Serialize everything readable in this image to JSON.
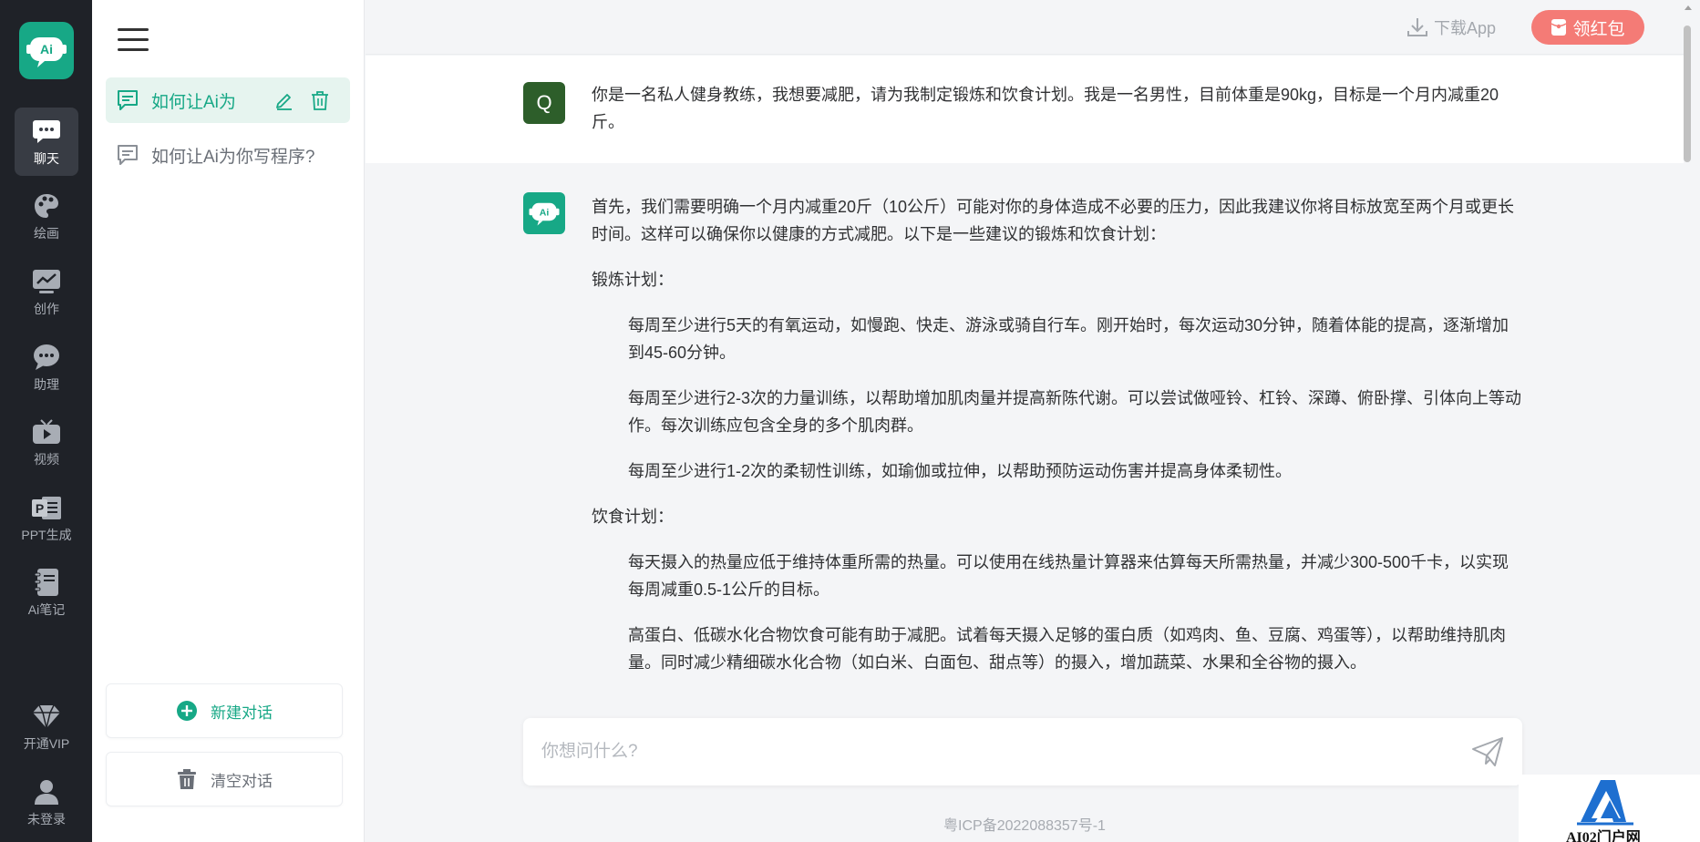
{
  "rail": {
    "logo_text": "Ai",
    "items": [
      {
        "label": "聊天",
        "icon": "chat-bubble-icon",
        "active": true
      },
      {
        "label": "绘画",
        "icon": "palette-icon",
        "active": false
      },
      {
        "label": "创作",
        "icon": "chart-board-icon",
        "active": false
      },
      {
        "label": "助理",
        "icon": "assistant-bubble-icon",
        "active": false
      },
      {
        "label": "视频",
        "icon": "tv-icon",
        "active": false
      },
      {
        "label": "PPT生成",
        "icon": "ppt-icon",
        "active": false
      },
      {
        "label": "Ai笔记",
        "icon": "notebook-icon",
        "active": false
      }
    ],
    "vip_label": "开通VIP",
    "login_label": "未登录"
  },
  "history": {
    "items": [
      {
        "title": "如何让Ai为",
        "active": true
      },
      {
        "title": "如何让Ai为你写程序?",
        "active": false
      }
    ],
    "new_chat_label": "新建对话",
    "clear_label": "清空对话"
  },
  "topbar": {
    "download_label": "下载App",
    "red_packet_label": "领红包"
  },
  "conversation": {
    "user_avatar": "Q",
    "question": "你是一名私人健身教练，我想要减肥，请为我制定锻炼和饮食计划。我是一名男性，目前体重是90kg，目标是一个月内减重20斤。",
    "answer": {
      "intro": "首先，我们需要明确一个月内减重20斤（10公斤）可能对你的身体造成不必要的压力，因此我建议你将目标放宽至两个月或更长时间。这样可以确保你以健康的方式减肥。以下是一些建议的锻炼和饮食计划：",
      "exercise_heading": "锻炼计划：",
      "exercise_items": [
        "每周至少进行5天的有氧运动，如慢跑、快走、游泳或骑自行车。刚开始时，每次运动30分钟，随着体能的提高，逐渐增加到45-60分钟。",
        "每周至少进行2-3次的力量训练，以帮助增加肌肉量并提高新陈代谢。可以尝试做哑铃、杠铃、深蹲、俯卧撑、引体向上等动作。每次训练应包含全身的多个肌肉群。",
        "每周至少进行1-2次的柔韧性训练，如瑜伽或拉伸，以帮助预防运动伤害并提高身体柔韧性。"
      ],
      "diet_heading": "饮食计划：",
      "diet_items": [
        "每天摄入的热量应低于维持体重所需的热量。可以使用在线热量计算器来估算每天所需热量，并减少300-500千卡，以实现每周减重0.5-1公斤的目标。",
        "高蛋白、低碳水化合物饮食可能有助于减肥。试着每天摄入足够的蛋白质（如鸡肉、鱼、豆腐、鸡蛋等），以帮助维持肌肉量。同时减少精细碳水化合物（如白米、白面包、甜点等）的摄入，增加蔬菜、水果和全谷物的摄入。"
      ]
    }
  },
  "input": {
    "placeholder": "你想问什么?",
    "value": ""
  },
  "footer": {
    "icp": "粤ICP备2022088357号-1"
  },
  "watermark": {
    "text": "AI02门户网"
  },
  "colors": {
    "brand": "#17a886",
    "rail_bg": "#1f2228",
    "red_packet": "#f47b76",
    "user_avatar_bg": "#2d5e2a"
  }
}
